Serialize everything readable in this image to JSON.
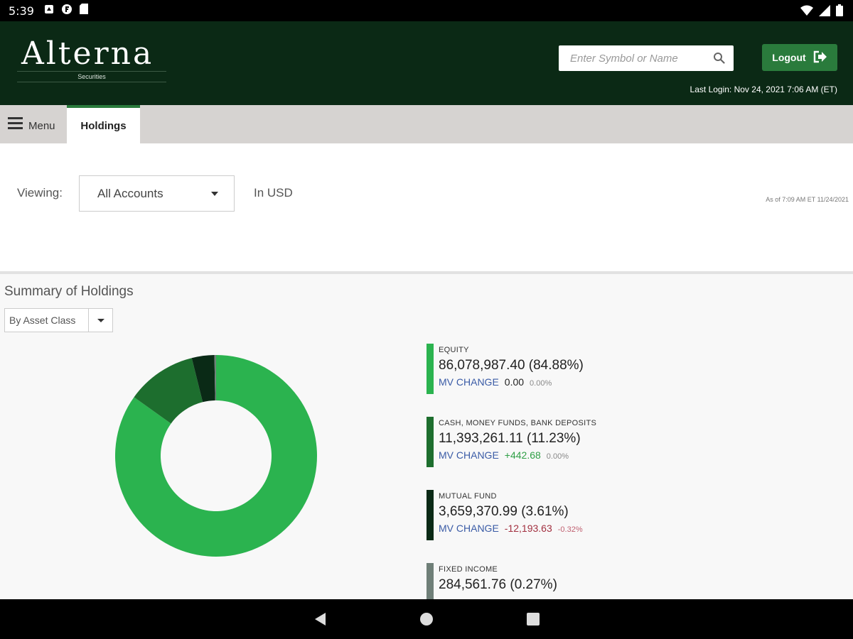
{
  "status_bar": {
    "time": "5:39"
  },
  "header": {
    "logo_name": "Alterna",
    "logo_sub": "Securities",
    "search_placeholder": "Enter Symbol or Name",
    "logout_label": "Logout",
    "last_login": "Last Login: Nov 24, 2021 7:06 AM (ET)"
  },
  "tabs": {
    "menu_label": "Menu",
    "active_tab": "Holdings"
  },
  "viewing": {
    "label": "Viewing:",
    "selected_account": "All Accounts",
    "currency": "In USD",
    "as_of": "As of 7:09 AM ET 11/24/2021"
  },
  "summary": {
    "title": "Summary of Holdings",
    "group_by": "By Asset Class",
    "items": [
      {
        "name": "EQUITY",
        "value": "86,078,987.40 (84.88%)",
        "mv_label": "MV CHANGE",
        "mv_amount": "0.00",
        "mv_pct": "0.00%",
        "color": "#2bb34f",
        "direction": "flat"
      },
      {
        "name": "CASH, MONEY FUNDS, BANK DEPOSITS",
        "value": "11,393,261.11 (11.23%)",
        "mv_label": "MV CHANGE",
        "mv_amount": "+442.68",
        "mv_pct": "0.00%",
        "color": "#1d6e2e",
        "direction": "up"
      },
      {
        "name": "MUTUAL FUND",
        "value": "3,659,370.99 (3.61%)",
        "mv_label": "MV CHANGE",
        "mv_amount": "-12,193.63",
        "mv_pct": "-0.32%",
        "color": "#0a2a16",
        "direction": "down"
      },
      {
        "name": "FIXED INCOME",
        "value": "284,561.76 (0.27%)",
        "color": "#6f7f78"
      }
    ]
  },
  "chart_data": {
    "type": "pie",
    "categories": [
      "EQUITY",
      "CASH, MONEY FUNDS, BANK DEPOSITS",
      "MUTUAL FUND",
      "FIXED INCOME"
    ],
    "values": [
      84.88,
      11.23,
      3.61,
      0.27
    ],
    "colors": [
      "#2bb34f",
      "#1d6e2e",
      "#0a2a16",
      "#6f7f78"
    ]
  }
}
